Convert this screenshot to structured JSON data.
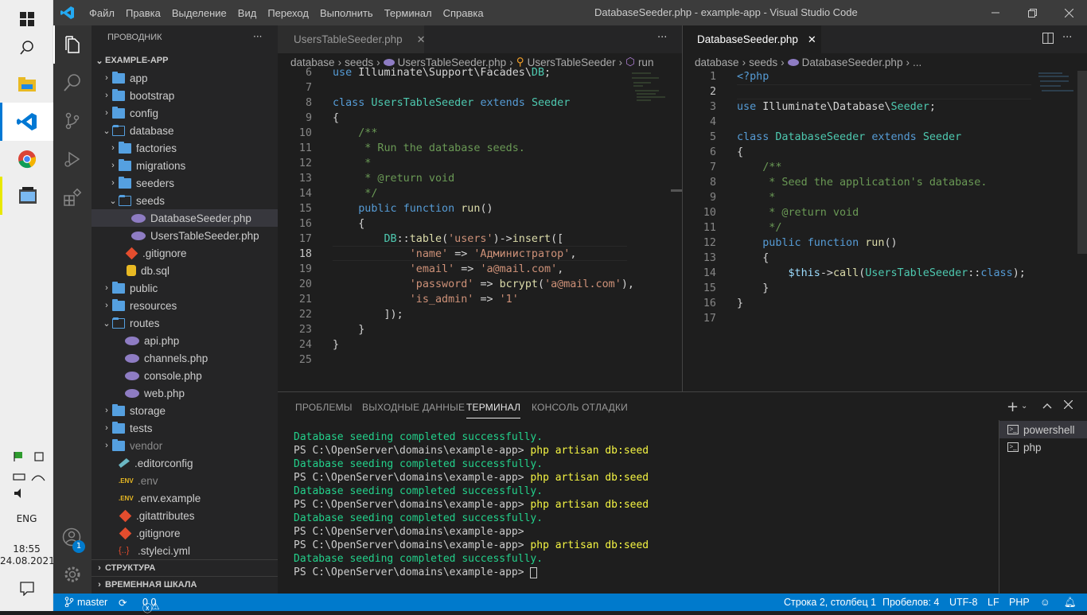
{
  "taskbar": {
    "clock_time": "18:55",
    "clock_date": "24.08.2021",
    "lang": "ENG",
    "notification_count": "1"
  },
  "window": {
    "title": "DatabaseSeeder.php - example-app - Visual Studio Code",
    "menu": [
      "Файл",
      "Правка",
      "Выделение",
      "Вид",
      "Переход",
      "Выполнить",
      "Терминал",
      "Справка"
    ]
  },
  "sidebar": {
    "header": "ПРОВОДНИК",
    "more": "···",
    "root": "EXAMPLE-APP",
    "items": [
      {
        "label": "app",
        "type": "folder",
        "depth": 1,
        "expanded": false
      },
      {
        "label": "bootstrap",
        "type": "folder",
        "depth": 1,
        "expanded": false
      },
      {
        "label": "config",
        "type": "folder",
        "depth": 1,
        "expanded": false
      },
      {
        "label": "database",
        "type": "folder",
        "depth": 1,
        "expanded": true
      },
      {
        "label": "factories",
        "type": "folder",
        "depth": 2,
        "expanded": false
      },
      {
        "label": "migrations",
        "type": "folder",
        "depth": 2,
        "expanded": false
      },
      {
        "label": "seeders",
        "type": "folder",
        "depth": 2,
        "expanded": false
      },
      {
        "label": "seeds",
        "type": "folder",
        "depth": 2,
        "expanded": true
      },
      {
        "label": "DatabaseSeeder.php",
        "type": "php",
        "depth": 3,
        "selected": true
      },
      {
        "label": "UsersTableSeeder.php",
        "type": "php",
        "depth": 3
      },
      {
        "label": ".gitignore",
        "type": "git",
        "depth": 2
      },
      {
        "label": "db.sql",
        "type": "db",
        "depth": 2
      },
      {
        "label": "public",
        "type": "folder",
        "depth": 1,
        "expanded": false
      },
      {
        "label": "resources",
        "type": "folder",
        "depth": 1,
        "expanded": false
      },
      {
        "label": "routes",
        "type": "folder",
        "depth": 1,
        "expanded": true
      },
      {
        "label": "api.php",
        "type": "php",
        "depth": 2
      },
      {
        "label": "channels.php",
        "type": "php",
        "depth": 2
      },
      {
        "label": "console.php",
        "type": "php",
        "depth": 2
      },
      {
        "label": "web.php",
        "type": "php",
        "depth": 2
      },
      {
        "label": "storage",
        "type": "folder",
        "depth": 1,
        "expanded": false
      },
      {
        "label": "tests",
        "type": "folder",
        "depth": 1,
        "expanded": false
      },
      {
        "label": "vendor",
        "type": "folder",
        "depth": 1,
        "expanded": false,
        "dim": true
      },
      {
        "label": ".editorconfig",
        "type": "editorconfig",
        "depth": 1
      },
      {
        "label": ".env",
        "type": "env",
        "depth": 1,
        "dim": true
      },
      {
        "label": ".env.example",
        "type": "env",
        "depth": 1
      },
      {
        "label": ".gitattributes",
        "type": "git",
        "depth": 1
      },
      {
        "label": ".gitignore",
        "type": "git",
        "depth": 1
      },
      {
        "label": ".styleci.yml",
        "type": "yml",
        "depth": 1
      }
    ],
    "outline": "СТРУКТУРА",
    "timeline": "ВРЕМЕННАЯ ШКАЛА"
  },
  "editor_left": {
    "tab": "UsersTableSeeder.php",
    "breadcrumb": [
      "database",
      "seeds",
      "UsersTableSeeder.php",
      "UsersTableSeeder",
      "run"
    ],
    "line_numbers": [
      "6",
      "7",
      "8",
      "9",
      "10",
      "11",
      "12",
      "13",
      "14",
      "15",
      "16",
      "17",
      "18",
      "19",
      "20",
      "21",
      "22",
      "23",
      "24",
      "25"
    ],
    "active_line": "18"
  },
  "editor_right": {
    "tab": "DatabaseSeeder.php",
    "breadcrumb": [
      "database",
      "seeds",
      "DatabaseSeeder.php",
      "..."
    ],
    "line_numbers": [
      "1",
      "2",
      "3",
      "4",
      "5",
      "6",
      "7",
      "8",
      "9",
      "10",
      "11",
      "12",
      "13",
      "14",
      "15",
      "16",
      "17"
    ],
    "active_line": "2"
  },
  "panel": {
    "tabs": [
      "ПРОБЛЕМЫ",
      "ВЫХОДНЫЕ ДАННЫЕ",
      "ТЕРМИНАЛ",
      "КОНСОЛЬ ОТЛАДКИ"
    ],
    "active_tab": "ТЕРМИНАЛ",
    "terminals": [
      "powershell",
      "php"
    ],
    "prompt": "PS C:\\OpenServer\\domains\\example-app>",
    "success": "Database seeding completed successfully.",
    "command": "php artisan db:seed"
  },
  "statusbar": {
    "branch": "master",
    "errors": "0",
    "warnings": "0",
    "position": "Строка 2, столбец 1",
    "spaces": "Пробелов: 4",
    "encoding": "UTF-8",
    "eol": "LF",
    "language": "PHP"
  },
  "colors": {
    "accent": "#007acc",
    "sidebar": "#252526",
    "editor": "#1e1e1e",
    "titlebar": "#3c3c3c"
  }
}
